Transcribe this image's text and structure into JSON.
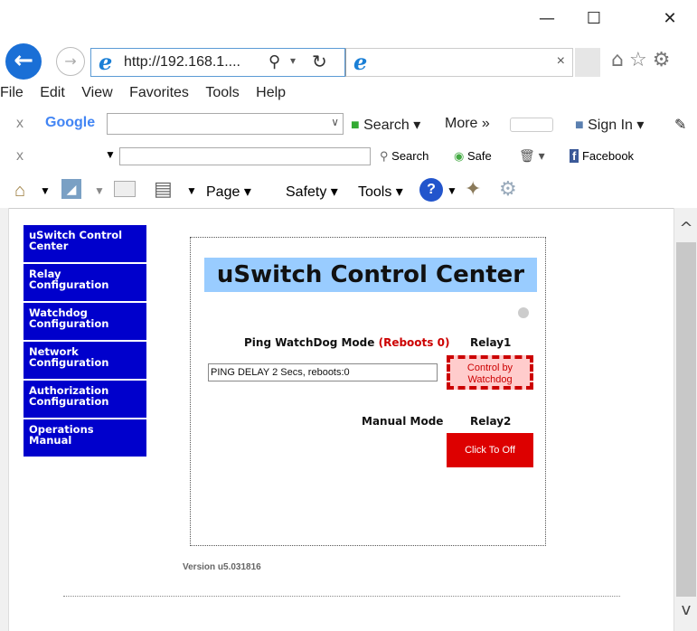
{
  "window": {
    "minimize": "—",
    "maximize": "☐",
    "close": "✕"
  },
  "browser": {
    "url": "http://192.168.1....",
    "search_glyph": "⚲",
    "menu": [
      "File",
      "Edit",
      "View",
      "Favorites",
      "Tools",
      "Help"
    ],
    "google_toolbar": {
      "close": "x",
      "brand": "Google",
      "search_label": "Search",
      "more_label": "More »",
      "signin_label": "Sign In"
    },
    "second_toolbar": {
      "close": "x",
      "search_label": "Search",
      "safe_label": "Safe",
      "facebook_label": "Facebook"
    },
    "command_bar": {
      "page_label": "Page",
      "safety_label": "Safety",
      "tools_label": "Tools"
    }
  },
  "nav": {
    "items": [
      {
        "line1": "uSwitch Control",
        "line2": "Center"
      },
      {
        "line1": "Relay",
        "line2": "Configuration"
      },
      {
        "line1": "Watchdog",
        "line2": "Configuration"
      },
      {
        "line1": "Network",
        "line2": "Configuration"
      },
      {
        "line1": "Authorization",
        "line2": "Configuration"
      },
      {
        "line1": "Operations",
        "line2": "Manual"
      }
    ]
  },
  "main": {
    "title": "uSwitch Control Center",
    "ping_mode_label": "Ping WatchDog Mode",
    "reboots_label": "(Reboots 0)",
    "relay1_label": "Relay1",
    "status_text": "PING DELAY 2 Secs, reboots:0",
    "relay1_button_line1": "Control by",
    "relay1_button_line2": "Watchdog",
    "manual_mode_label": "Manual Mode",
    "relay2_label": "Relay2",
    "relay2_button": "Click To Off",
    "version": "Version u5.031816"
  },
  "colors": {
    "nav_bg": "#0000cc",
    "banner_bg": "#99ccff",
    "alert_red": "#cc0000",
    "relay1_bg": "#ffcccc",
    "relay2_bg": "#dd0000"
  }
}
